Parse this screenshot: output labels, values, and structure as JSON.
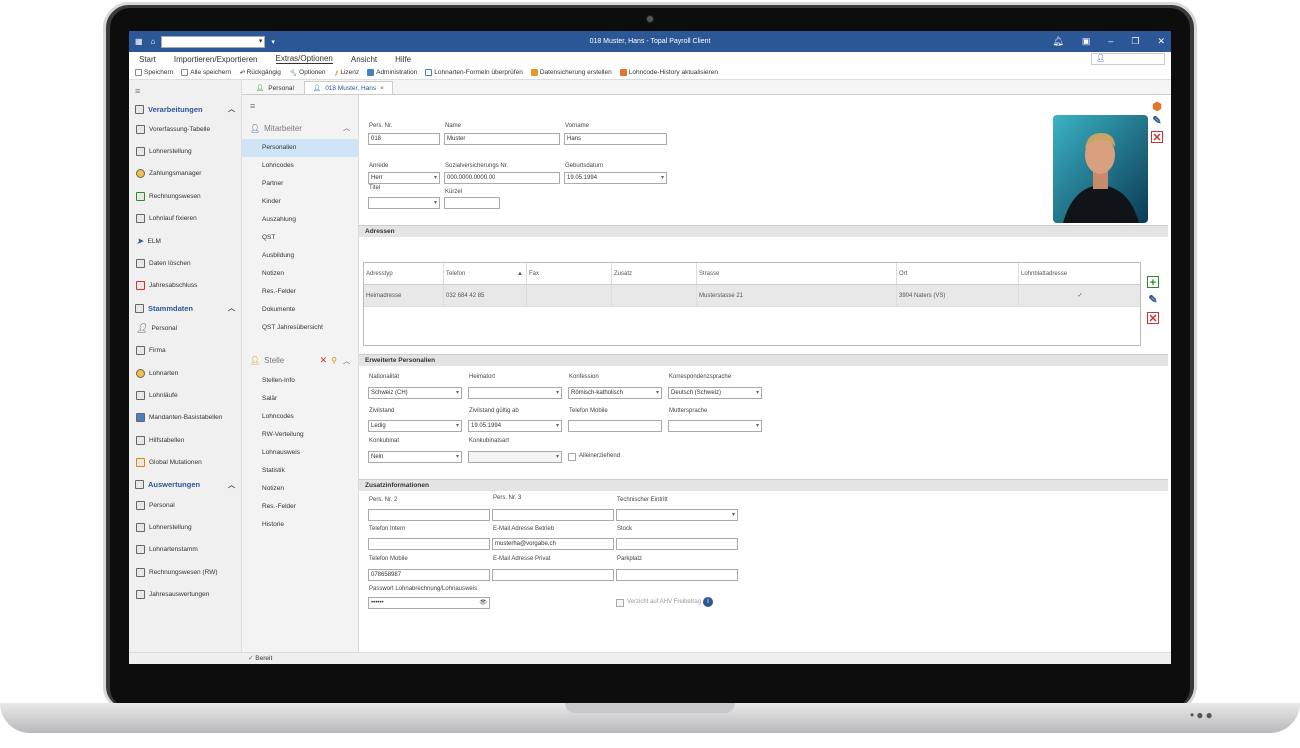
{
  "window": {
    "title": "018 Muster, Hans - Topal Payroll Client"
  },
  "menu": [
    "Start",
    "Importieren/Exportieren",
    "Extras/Optionen",
    "Ansicht",
    "Hilfe"
  ],
  "toolbar": [
    "Speichern",
    "Alle speichern",
    "Rückgängig",
    "Optionen",
    "Lizenz",
    "Administration",
    "Lohnarten-Formeln überprüfen",
    "Datensicherung erstellen",
    "Lohncode-History aktualisieren"
  ],
  "nav": {
    "groups": [
      {
        "label": "Verarbeitungen",
        "items": [
          "Vorerfassung-Tabelle",
          "Lohnerstellung",
          "Zahlungsmanager",
          "Rechnungswesen",
          "Lohnlauf fixieren",
          "ELM",
          "Daten löschen",
          "Jahresabschluss"
        ]
      },
      {
        "label": "Stammdaten",
        "items": [
          "Personal",
          "Firma",
          "Lohnarten",
          "Lohnläufe",
          "Mandanten-Basistabellen",
          "Hilfstabellen",
          "Global Mutationen"
        ]
      },
      {
        "label": "Auswertungen",
        "items": [
          "Personal",
          "Lohnerstellung",
          "Lohnartenstamm",
          "Rechnungswesen (RW)",
          "Jahresauswertungen"
        ]
      }
    ]
  },
  "tabs": [
    "Personal",
    "018 Muster, Hans"
  ],
  "sub": {
    "mitarbeiter_label": "Mitarbeiter",
    "mitarbeiter": [
      "Personalien",
      "Lohncodes",
      "Partner",
      "Kinder",
      "Auszahlung",
      "QST",
      "Ausbildung",
      "Notizen",
      "Res.-Felder",
      "Dokumente",
      "QST Jahresübersicht"
    ],
    "stelle_label": "Stelle",
    "stelle": [
      "Stellen-Info",
      "Salär",
      "Lohncodes",
      "RW-Verteilung",
      "Lohnausweis",
      "Statistik",
      "Notizen",
      "Res.-Felder",
      "Historie"
    ]
  },
  "status": "Bereit",
  "personal": {
    "pers_nr_label": "Pers. Nr.",
    "pers_nr": "018",
    "name_label": "Name",
    "name": "Muster",
    "vorname_label": "Vorname",
    "vorname": "Hans",
    "anrede_label": "Anrede",
    "anrede": "Herr",
    "sv_label": "Sozialversicherungs Nr.",
    "sv": "000.0000.0000.00",
    "geburt_label": "Geburtsdatum",
    "geburt": "19.05.1994",
    "titel_label": "Titel",
    "kuerzel_label": "Kürzel"
  },
  "adressen": {
    "section": "Adressen",
    "columns": [
      "Adresstyp",
      "Telefon",
      "Fax",
      "Zusatz",
      "Strasse",
      "Ort",
      "Lohnblattadresse"
    ],
    "row": [
      "Heimadresse",
      "032 684 42 85",
      "",
      "",
      "Musterstasse 21",
      "3904 Naters (VS)",
      "✓"
    ]
  },
  "erweitert": {
    "section": "Erweiterte Personalien",
    "nationalitaet_label": "Nationalität",
    "nationalitaet": "Schweiz (CH)",
    "heimatort_label": "Heimatort",
    "konfession_label": "Konfession",
    "konfession": "Römisch-katholisch",
    "korr_label": "Korrespondenzsprache",
    "korr": "Deutsch (Schweiz)",
    "zivil_label": "Zivilstand",
    "zivil": "Ledig",
    "zivil_ab_label": "Zivilstand gültig ab",
    "zivil_ab": "19.05.1994",
    "tel_mob_label": "Telefon Mobile",
    "mutter_label": "Muttersprache",
    "konk_label": "Konkubinat",
    "konk": "Nein",
    "konkart_label": "Konkubinatsart",
    "allein_label": "Alleinerziehend"
  },
  "zusatz": {
    "section": "Zusatzinformationen",
    "pn2_label": "Pers. Nr. 2",
    "pn3_label": "Pers. Nr. 3",
    "tech_label": "Technischer Eintritt",
    "tel_int_label": "Telefon Intern",
    "email_b_label": "E-Mail Adresse Betrieb",
    "email_b": "musterha@vorgabe.ch",
    "stock_label": "Stock",
    "mob_label": "Telefon Mobile",
    "mob": "078658987",
    "email_p_label": "E-Mail Adresse Privat",
    "park_label": "Parkplatz",
    "pw_label": "Passwort Lohnabrechnung/Lohnausweis",
    "pw": "••••••",
    "ahv_label": "Verzicht auf AHV Freibetrag"
  }
}
